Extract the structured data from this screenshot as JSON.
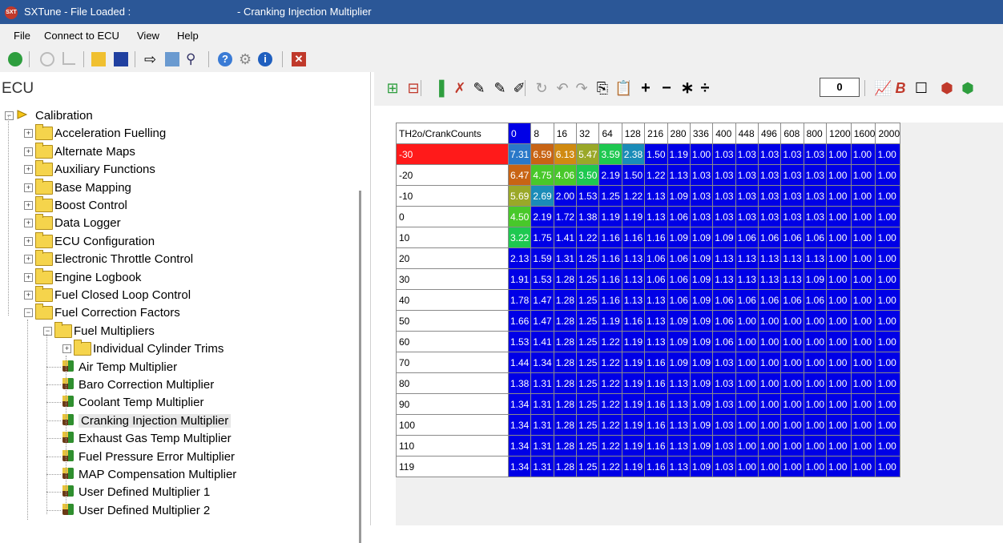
{
  "window": {
    "app_title": "SXTune - File Loaded :",
    "map_title": "- Cranking Injection Multiplier",
    "logo_text": "SXT"
  },
  "menu": {
    "items": [
      "File",
      "Connect to ECU",
      "View",
      "Help"
    ]
  },
  "toolbar": {
    "icons": [
      "power-icon",
      "clock-icon",
      "graph-icon",
      "open-folder-icon",
      "save-icon",
      "send-icon",
      "copy-icon",
      "search-icon",
      "help-icon",
      "gear-icon",
      "info-icon",
      "close-icon"
    ]
  },
  "left": {
    "title": "ECU",
    "tree": [
      {
        "label": "Calibration",
        "level": 0,
        "kind": "root",
        "exp": "−"
      },
      {
        "label": "Acceleration Fuelling",
        "level": 1,
        "kind": "folder",
        "exp": "+"
      },
      {
        "label": "Alternate Maps",
        "level": 1,
        "kind": "folder",
        "exp": "+"
      },
      {
        "label": "Auxiliary Functions",
        "level": 1,
        "kind": "folder",
        "exp": "+"
      },
      {
        "label": "Base Mapping",
        "level": 1,
        "kind": "folder",
        "exp": "+"
      },
      {
        "label": "Boost Control",
        "level": 1,
        "kind": "folder",
        "exp": "+"
      },
      {
        "label": "Data Logger",
        "level": 1,
        "kind": "folder",
        "exp": "+"
      },
      {
        "label": "ECU Configuration",
        "level": 1,
        "kind": "folder",
        "exp": "+"
      },
      {
        "label": "Electronic Throttle Control",
        "level": 1,
        "kind": "folder",
        "exp": "+"
      },
      {
        "label": "Engine Logbook",
        "level": 1,
        "kind": "folder",
        "exp": "+"
      },
      {
        "label": "Fuel Closed Loop Control",
        "level": 1,
        "kind": "folder",
        "exp": "+"
      },
      {
        "label": "Fuel Correction Factors",
        "level": 1,
        "kind": "folder",
        "exp": "−"
      },
      {
        "label": "Fuel Multipliers",
        "level": 2,
        "kind": "folder",
        "exp": "−"
      },
      {
        "label": "Individual Cylinder Trims",
        "level": 3,
        "kind": "folder",
        "exp": "+"
      },
      {
        "label": "Air Temp Multiplier",
        "level": 3,
        "kind": "map",
        "exp": ""
      },
      {
        "label": "Baro Correction Multiplier",
        "level": 3,
        "kind": "map",
        "exp": ""
      },
      {
        "label": "Coolant Temp Multiplier",
        "level": 3,
        "kind": "map",
        "exp": ""
      },
      {
        "label": "Cranking Injection Multiplier",
        "level": 3,
        "kind": "map",
        "exp": "",
        "selected": true
      },
      {
        "label": "Exhaust Gas Temp Multiplier",
        "level": 3,
        "kind": "map",
        "exp": ""
      },
      {
        "label": "Fuel Pressure Error Multiplier",
        "level": 3,
        "kind": "map",
        "exp": ""
      },
      {
        "label": "MAP Compensation Multiplier",
        "level": 3,
        "kind": "map",
        "exp": ""
      },
      {
        "label": "User Defined Multiplier 1",
        "level": 3,
        "kind": "map",
        "exp": ""
      },
      {
        "label": "User Defined Multiplier 2",
        "level": 3,
        "kind": "map",
        "exp": ""
      }
    ]
  },
  "map_toolbar": {
    "glyphs": [
      "⊞",
      "⊟",
      "▐",
      "✗",
      "✎",
      "✎",
      "✐",
      "↻",
      "↶",
      "↷",
      "⎘",
      "📋",
      "+",
      "−",
      "∗",
      "÷"
    ],
    "value": "0",
    "right_glyphs": [
      "📈",
      "B",
      "☐",
      "⬢",
      "⬢"
    ]
  },
  "table": {
    "corner": "TH2o/CrankCounts",
    "cols": [
      "0",
      "8",
      "16",
      "32",
      "64",
      "128",
      "216",
      "280",
      "336",
      "400",
      "448",
      "496",
      "608",
      "800",
      "1200",
      "1600",
      "2000"
    ],
    "rows": [
      "-30",
      "-20",
      "-10",
      "0",
      "10",
      "20",
      "30",
      "40",
      "50",
      "60",
      "70",
      "80",
      "90",
      "100",
      "110",
      "119"
    ],
    "values": [
      [
        "7.31",
        "6.59",
        "6.13",
        "5.47",
        "3.59",
        "2.38",
        "1.50",
        "1.19",
        "1.00",
        "1.03",
        "1.03",
        "1.03",
        "1.03",
        "1.03",
        "1.00",
        "1.00",
        "1.00"
      ],
      [
        "6.47",
        "4.75",
        "4.06",
        "3.50",
        "2.19",
        "1.50",
        "1.22",
        "1.13",
        "1.03",
        "1.03",
        "1.03",
        "1.03",
        "1.03",
        "1.03",
        "1.00",
        "1.00",
        "1.00"
      ],
      [
        "5.69",
        "2.69",
        "2.00",
        "1.53",
        "1.25",
        "1.22",
        "1.13",
        "1.09",
        "1.03",
        "1.03",
        "1.03",
        "1.03",
        "1.03",
        "1.03",
        "1.00",
        "1.00",
        "1.00"
      ],
      [
        "4.50",
        "2.19",
        "1.72",
        "1.38",
        "1.19",
        "1.19",
        "1.13",
        "1.06",
        "1.03",
        "1.03",
        "1.03",
        "1.03",
        "1.03",
        "1.03",
        "1.00",
        "1.00",
        "1.00"
      ],
      [
        "3.22",
        "1.75",
        "1.41",
        "1.22",
        "1.16",
        "1.16",
        "1.16",
        "1.09",
        "1.09",
        "1.09",
        "1.06",
        "1.06",
        "1.06",
        "1.06",
        "1.00",
        "1.00",
        "1.00"
      ],
      [
        "2.13",
        "1.59",
        "1.31",
        "1.25",
        "1.16",
        "1.13",
        "1.06",
        "1.06",
        "1.09",
        "1.13",
        "1.13",
        "1.13",
        "1.13",
        "1.13",
        "1.00",
        "1.00",
        "1.00"
      ],
      [
        "1.91",
        "1.53",
        "1.28",
        "1.25",
        "1.16",
        "1.13",
        "1.06",
        "1.06",
        "1.09",
        "1.13",
        "1.13",
        "1.13",
        "1.13",
        "1.09",
        "1.00",
        "1.00",
        "1.00"
      ],
      [
        "1.78",
        "1.47",
        "1.28",
        "1.25",
        "1.16",
        "1.13",
        "1.13",
        "1.06",
        "1.09",
        "1.06",
        "1.06",
        "1.06",
        "1.06",
        "1.06",
        "1.00",
        "1.00",
        "1.00"
      ],
      [
        "1.66",
        "1.47",
        "1.28",
        "1.25",
        "1.19",
        "1.16",
        "1.13",
        "1.09",
        "1.09",
        "1.06",
        "1.00",
        "1.00",
        "1.00",
        "1.00",
        "1.00",
        "1.00",
        "1.00"
      ],
      [
        "1.53",
        "1.41",
        "1.28",
        "1.25",
        "1.22",
        "1.19",
        "1.13",
        "1.09",
        "1.09",
        "1.06",
        "1.00",
        "1.00",
        "1.00",
        "1.00",
        "1.00",
        "1.00",
        "1.00"
      ],
      [
        "1.44",
        "1.34",
        "1.28",
        "1.25",
        "1.22",
        "1.19",
        "1.16",
        "1.09",
        "1.09",
        "1.03",
        "1.00",
        "1.00",
        "1.00",
        "1.00",
        "1.00",
        "1.00",
        "1.00"
      ],
      [
        "1.38",
        "1.31",
        "1.28",
        "1.25",
        "1.22",
        "1.19",
        "1.16",
        "1.13",
        "1.09",
        "1.03",
        "1.00",
        "1.00",
        "1.00",
        "1.00",
        "1.00",
        "1.00",
        "1.00"
      ],
      [
        "1.34",
        "1.31",
        "1.28",
        "1.25",
        "1.22",
        "1.19",
        "1.16",
        "1.13",
        "1.09",
        "1.03",
        "1.00",
        "1.00",
        "1.00",
        "1.00",
        "1.00",
        "1.00",
        "1.00"
      ],
      [
        "1.34",
        "1.31",
        "1.28",
        "1.25",
        "1.22",
        "1.19",
        "1.16",
        "1.13",
        "1.09",
        "1.03",
        "1.00",
        "1.00",
        "1.00",
        "1.00",
        "1.00",
        "1.00",
        "1.00"
      ],
      [
        "1.34",
        "1.31",
        "1.28",
        "1.25",
        "1.22",
        "1.19",
        "1.16",
        "1.13",
        "1.09",
        "1.03",
        "1.00",
        "1.00",
        "1.00",
        "1.00",
        "1.00",
        "1.00",
        "1.00"
      ],
      [
        "1.34",
        "1.31",
        "1.28",
        "1.25",
        "1.22",
        "1.19",
        "1.16",
        "1.13",
        "1.09",
        "1.03",
        "1.00",
        "1.00",
        "1.00",
        "1.00",
        "1.00",
        "1.00",
        "1.00"
      ]
    ],
    "selected_row": 0,
    "selected_col": 0,
    "colors": {
      "low": "#0000e6",
      "selected_header_row": "#ff1a1a"
    }
  }
}
